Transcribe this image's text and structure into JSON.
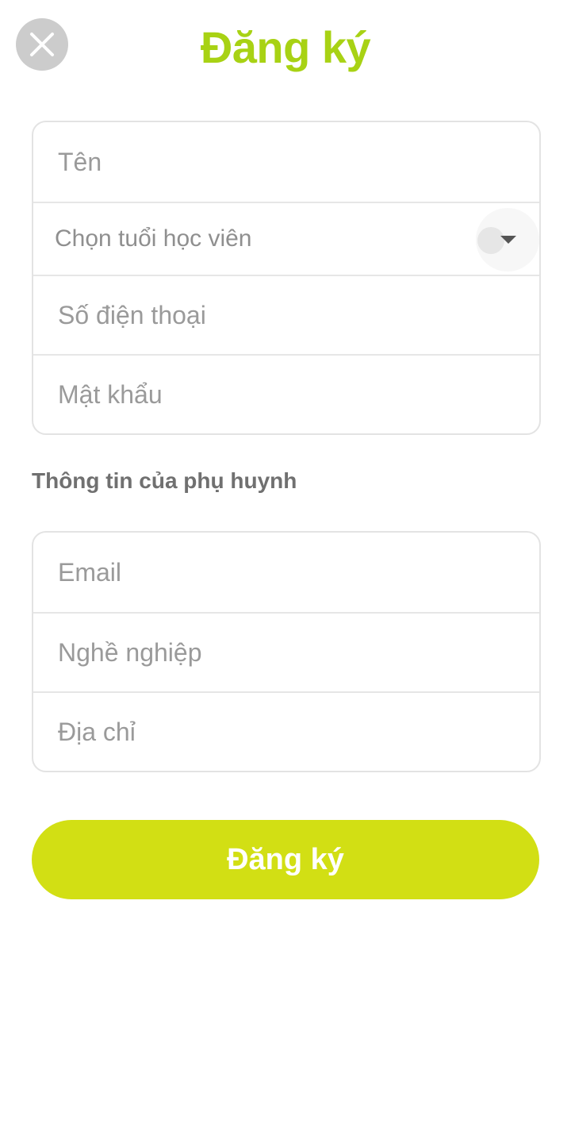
{
  "header": {
    "title": "Đăng ký",
    "close_icon": "close-icon"
  },
  "student_form": {
    "name": {
      "placeholder": "Tên",
      "value": ""
    },
    "age_select": {
      "label": "Chọn tuổi học viên",
      "icon": "chevron-down-icon"
    },
    "phone": {
      "placeholder": "Số điện thoại",
      "value": ""
    },
    "password": {
      "placeholder": "Mật khẩu",
      "value": ""
    }
  },
  "parent_section": {
    "label": "Thông tin của phụ huynh"
  },
  "parent_form": {
    "email": {
      "placeholder": "Email",
      "value": ""
    },
    "occupation": {
      "placeholder": "Nghề nghiệp",
      "value": ""
    },
    "address": {
      "placeholder": "Địa chỉ",
      "value": ""
    }
  },
  "submit": {
    "label": "Đăng ký"
  },
  "colors": {
    "title": "#a8d214",
    "button": "#d2df14",
    "close_button_bg": "#cccccc",
    "border": "#e3e3e3",
    "placeholder": "#9a9a9a",
    "section_label": "#707070"
  }
}
